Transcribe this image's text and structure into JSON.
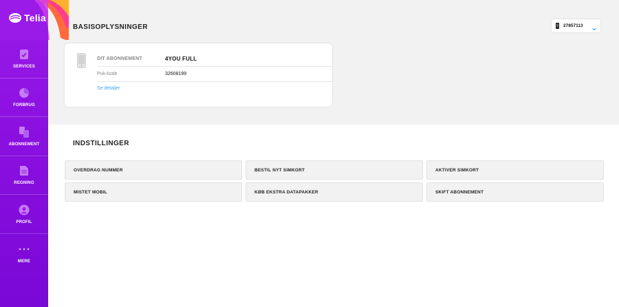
{
  "brand": {
    "name": "Telia",
    "accent": "#9a1be8",
    "link_color": "#3aa6e8"
  },
  "sidebar": {
    "items": [
      {
        "label": "SERVICES",
        "icon": "services-icon"
      },
      {
        "label": "FORBRUG",
        "icon": "usage-chart-icon"
      },
      {
        "label": "ABONNEMENT",
        "icon": "subscription-icon"
      },
      {
        "label": "REGNING",
        "icon": "bill-icon"
      },
      {
        "label": "PROFIL",
        "icon": "profile-icon"
      },
      {
        "label": "MERE",
        "icon": "more-dots-icon"
      }
    ]
  },
  "header": {
    "phone_selector": {
      "value": "27857113",
      "icon": "phone-icon"
    }
  },
  "basis": {
    "title": "BASISOPLYSNINGER",
    "subscription_label": "DIT ABONNEMENT",
    "subscription_value": "4YOU FULL",
    "puk_label": "Puk-kode",
    "puk_value": "32608199",
    "details_link": "Se detaljer"
  },
  "settings": {
    "title": "INDSTILLINGER",
    "buttons": [
      "OVERDRAG NUMMER",
      "BESTIL NYT SIMKORT",
      "AKTIVER SIMKORT",
      "MISTET MOBIL",
      "KØB EKSTRA DATAPAKKER",
      "SKIFT ABONNEMENT"
    ]
  }
}
